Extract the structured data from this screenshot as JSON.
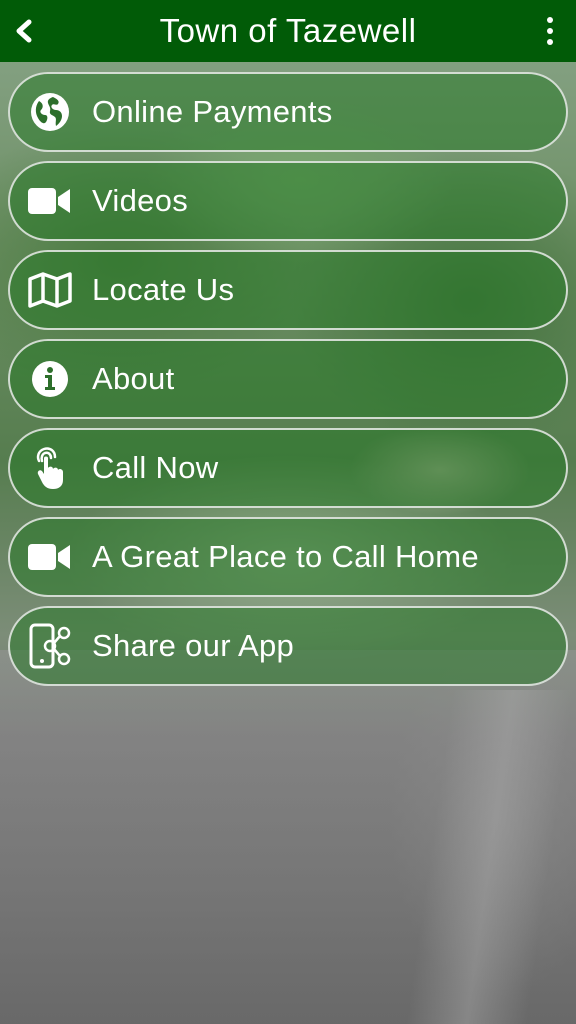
{
  "header": {
    "title": "Town of Tazewell",
    "back_icon": "chevron-left-icon",
    "menu_icon": "more-vertical-icon",
    "bar_color": "#015B07"
  },
  "menu": {
    "items": [
      {
        "label": "Online Payments",
        "icon": "globe-icon"
      },
      {
        "label": "Videos",
        "icon": "video-camera-icon"
      },
      {
        "label": "Locate Us",
        "icon": "map-icon"
      },
      {
        "label": "About",
        "icon": "info-icon"
      },
      {
        "label": "Call Now",
        "icon": "touch-icon"
      },
      {
        "label": "A Great Place to Call Home",
        "icon": "video-camera-icon"
      },
      {
        "label": "Share our App",
        "icon": "share-app-icon"
      }
    ],
    "item_fill": "rgba(40,120,40,0.55)",
    "item_border": "#ebebeb"
  }
}
